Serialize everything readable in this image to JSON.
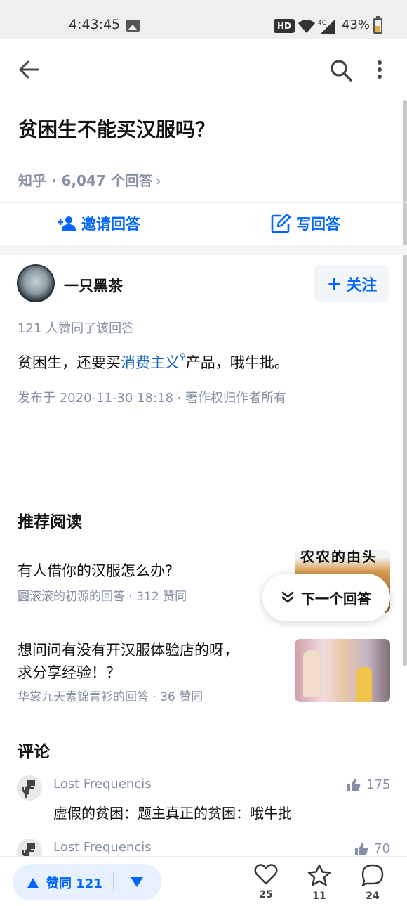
{
  "status_bar": {
    "time": "4:43:45",
    "hd_badge": "HD",
    "network": "4G",
    "battery": "43%"
  },
  "question": {
    "title": "贫困生不能买汉服吗？",
    "meta": "知乎 · 6,047 个回答",
    "meta_chevron": "›"
  },
  "actions": {
    "invite_label": "邀请回答",
    "write_label": "写回答"
  },
  "answer": {
    "author_name": "一只黑茶",
    "follow_label": "关注",
    "follow_plus": "+",
    "vote_text": "121 人赞同了该回答",
    "body_before": "贫困生，还要买",
    "body_link": "消费主义",
    "body_after": "产品，哦牛批。",
    "publish_info": "发布于 2020-11-30 18:18 · 著作权归作者所有"
  },
  "recommended": {
    "heading": "推荐阅读",
    "items": [
      {
        "title": "有人借你的汉服怎么办?",
        "meta": "圆滚滚的初源的回答 · 312 赞同",
        "thumb_text": "农农的由头"
      },
      {
        "title_line1": "想问问有没有开汉服体验店的呀，",
        "title_line2": "求分享经验！？",
        "meta": "华裳九天素锦青衫的回答 · 36 赞同"
      }
    ],
    "next_answer_label": "下一个回答"
  },
  "comments": {
    "heading": "评论",
    "items": [
      {
        "author": "Lost Frequencis",
        "likes": "175",
        "text": "虚假的贫困：题主真正的贫困：哦牛批"
      },
      {
        "author": "Lost Frequencis",
        "likes": "70"
      }
    ]
  },
  "bottom_bar": {
    "vote_label": "赞同 121",
    "like_count": "25",
    "favorite_count": "11",
    "comment_count": "24"
  },
  "colors": {
    "accent": "#0066ff",
    "meta_gray": "#8590a6",
    "link": "#1766c2"
  }
}
